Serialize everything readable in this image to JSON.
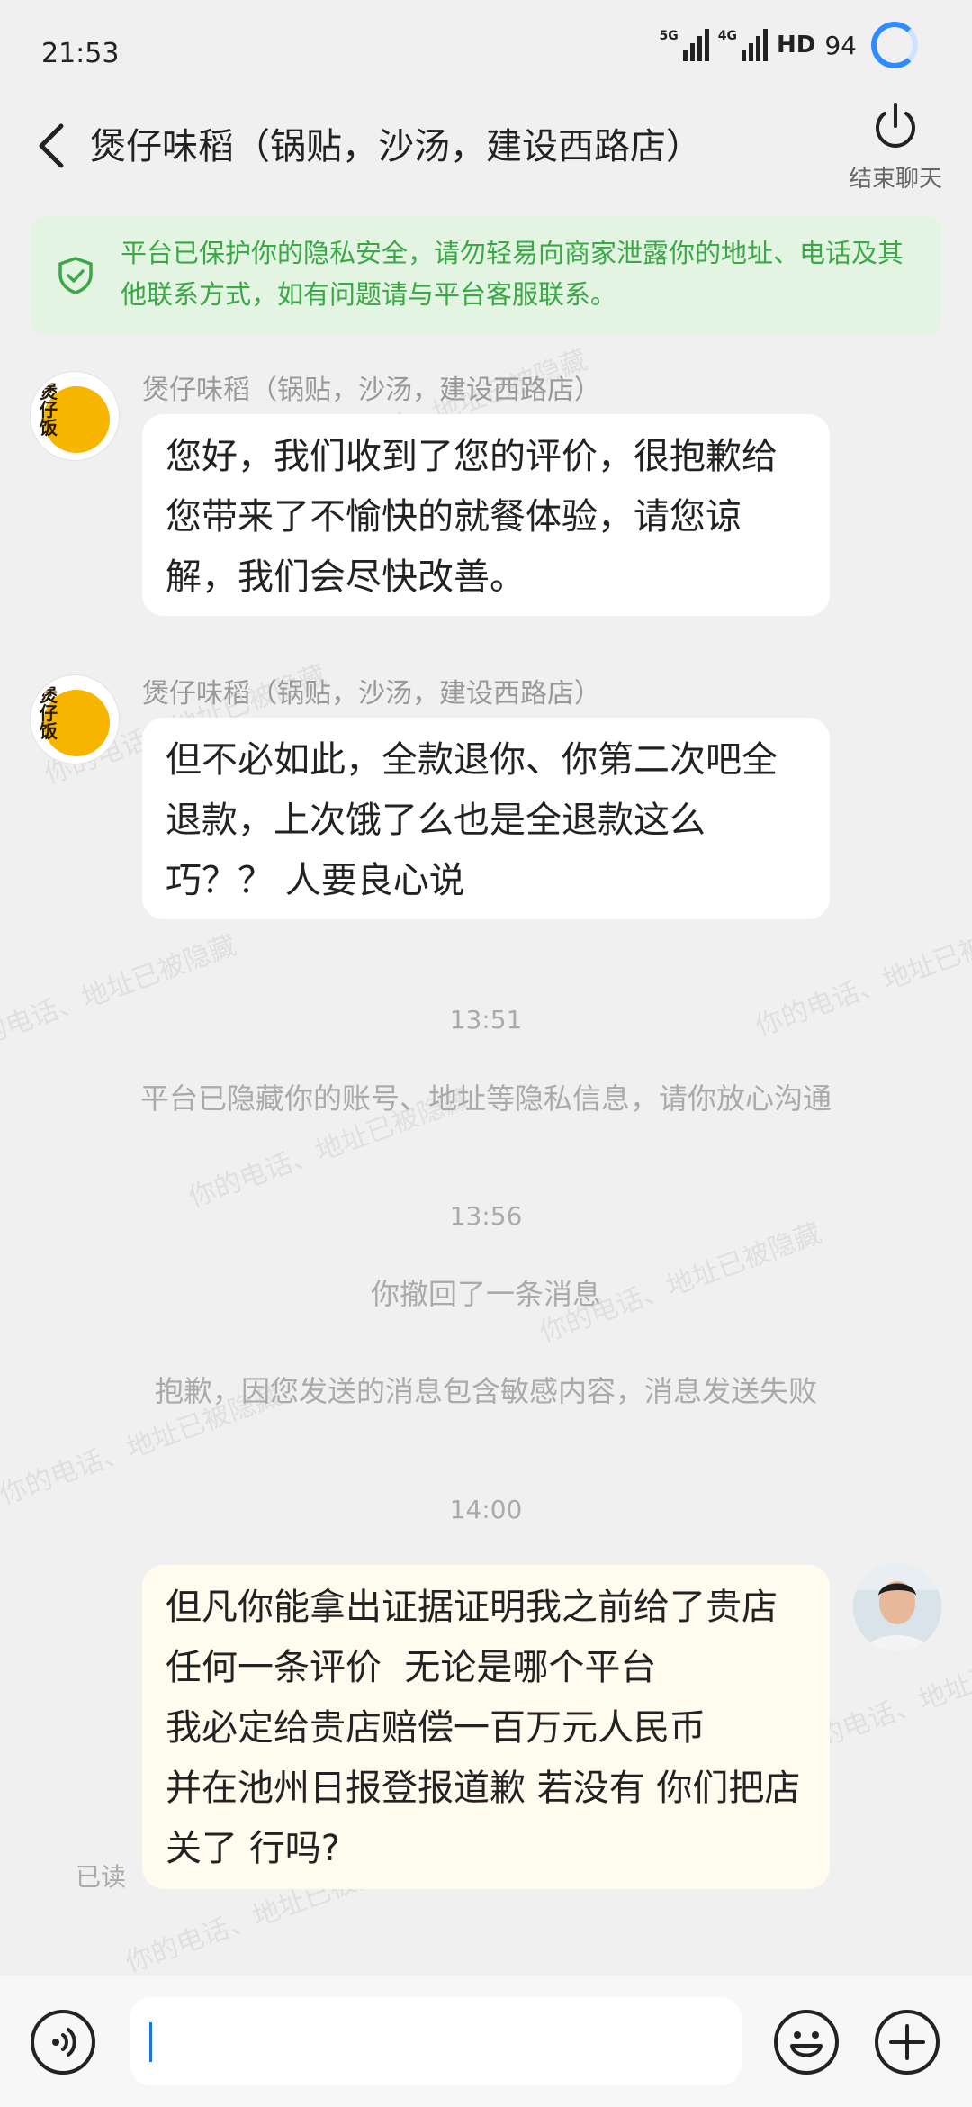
{
  "status_bar": {
    "time": "21:53",
    "network_5g": "5G",
    "network_4g": "4G",
    "hd_label": "HD",
    "battery": "94"
  },
  "header": {
    "title": "煲仔味稻（锅贴，沙汤，建设西路店）",
    "end_chat_label": "结束聊天"
  },
  "privacy_banner": {
    "text": "平台已保护你的隐私安全，请勿轻易向商家泄露你的地址、电话及其他联系方式，如有问题请与平台客服联系。"
  },
  "shop_avatar_text": "煲仔饭",
  "messages": [
    {
      "sender": "煲仔味稻（锅贴，沙汤，建设西路店）",
      "text": "您好，我们收到了您的评价，很抱歉给您带来了不愉快的就餐体验，请您谅解，我们会尽快改善。"
    },
    {
      "sender": "煲仔味稻（锅贴，沙汤，建设西路店）",
      "text": "但不必如此，全款退你、你第二次吧全退款，上次饿了么也是全退款这么巧？？ 人要良心说"
    }
  ],
  "timeline": {
    "ts1": "13:51",
    "sys1": "平台已隐藏你的账号、地址等隐私信息，请你放心沟通",
    "ts2": "13:56",
    "sys2": "你撤回了一条消息",
    "sys3": "抱歉，因您发送的消息包含敏感内容，消息发送失败",
    "ts3": "14:00"
  },
  "my_message": {
    "text": "但凡你能拿出证据证明我之前给了贵店任何一条评价  无论是哪个平台\n我必定给贵店赔偿一百万元人民币\n并在池州日报登报道歉 若没有 你们把店关了 行吗?",
    "read_status": "已读"
  },
  "watermark": "你的电话、地址已被隐藏",
  "input": {
    "value": ""
  }
}
